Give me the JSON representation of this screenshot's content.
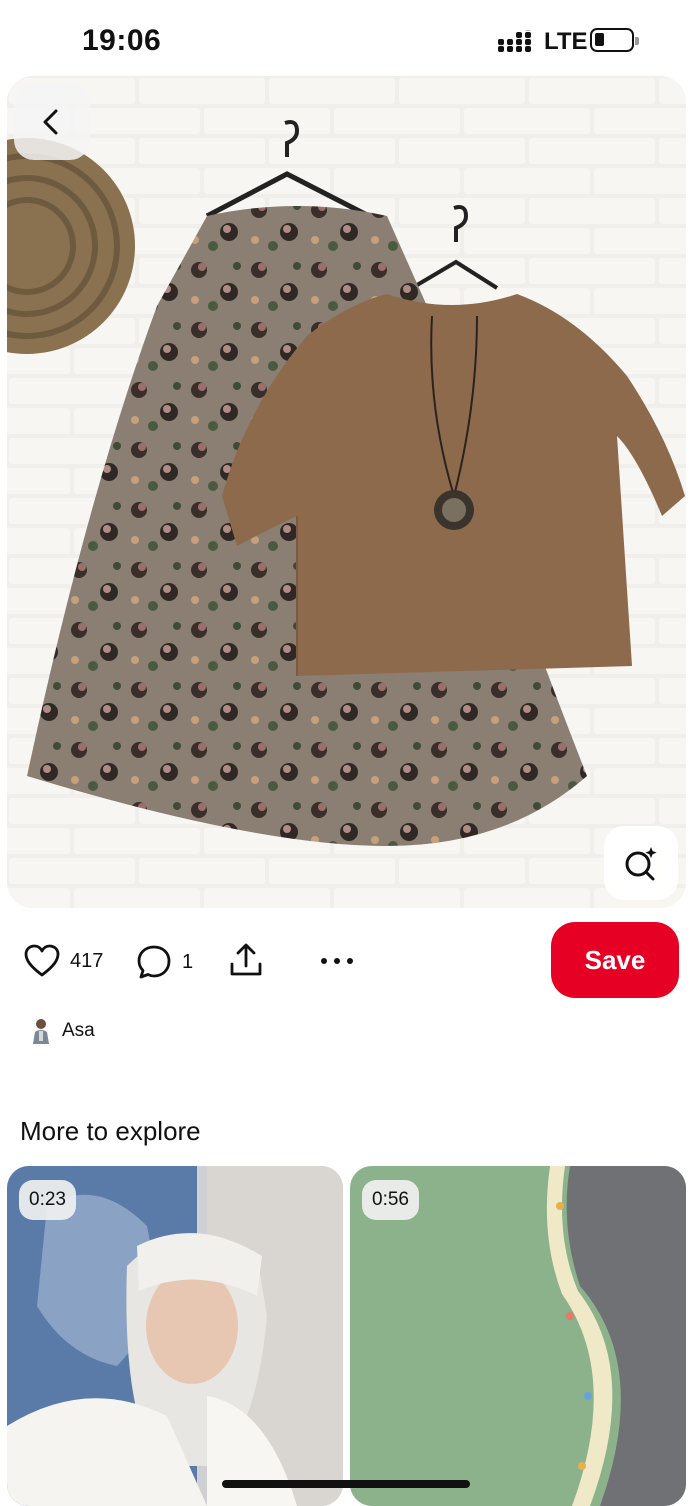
{
  "status_bar": {
    "time": "19:06",
    "network": "LTE",
    "battery_icon": "battery-low-icon",
    "signal_icon": "signal-dots-icon"
  },
  "pin": {
    "image_icon_back": "chevron-left-icon",
    "image_icon_lens": "visual-search-icon",
    "like_count": "417",
    "comment_count": "1",
    "save_label": "Save",
    "author": "Asa"
  },
  "more": {
    "title": "More to explore",
    "cards": [
      {
        "duration": "0:23"
      },
      {
        "duration": "0:56"
      }
    ]
  },
  "colors": {
    "accent": "#e60023",
    "text": "#111111",
    "background": "#ffffff"
  }
}
